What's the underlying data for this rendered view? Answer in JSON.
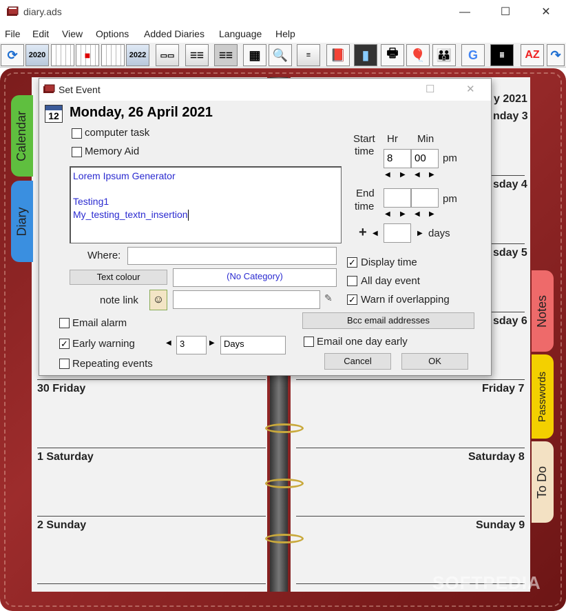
{
  "window": {
    "title": "diary.ads",
    "min_glyph": "—",
    "max_glyph": "☐",
    "close_glyph": "✕"
  },
  "menu": [
    "File",
    "Edit",
    "View",
    "Options",
    "Added Diaries",
    "Language",
    "Help"
  ],
  "toolbar": {
    "year_prev": "2020",
    "year_next": "2022",
    "sort_label": "AZ"
  },
  "diary": {
    "left_days": [
      "30 Friday",
      "1 Saturday",
      "2 Sunday"
    ],
    "right_days": [
      "Friday 7",
      "Saturday 8",
      "Sunday 9"
    ],
    "right_partial": [
      "y 2021",
      "nday 3",
      "sday 4",
      "sday 5",
      "sday 6"
    ],
    "tabs_left": [
      "Calendar",
      "Diary"
    ],
    "tabs_right": [
      "Notes",
      "Passwords",
      "To Do"
    ],
    "watermark": "SOFTPEDIA"
  },
  "dialog": {
    "title": "Set Event",
    "date_icon_day": "12",
    "date_heading": "Monday, 26 April 2021",
    "computer_task": {
      "label": "computer task",
      "checked": ""
    },
    "memory_aid": {
      "label": "Memory Aid",
      "checked": ""
    },
    "memo_lines": [
      "Lorem Ipsum Generator",
      "",
      "Testing1",
      "My_testing_textn_insertion"
    ],
    "where_label": "Where:",
    "where_value": "",
    "text_colour_button": "Text colour",
    "category_value": "(No Category)",
    "note_link_label": "note link",
    "note_link_value": "",
    "start_time_label": [
      "Start",
      "time"
    ],
    "hr_label": "Hr",
    "min_label": "Min",
    "start_hr": "8",
    "start_min": "00",
    "start_ampm": "pm",
    "end_time_label": [
      "End",
      "time"
    ],
    "end_hr": "",
    "end_min": "",
    "end_ampm": "pm",
    "days_plus": "+",
    "days_value": "",
    "days_label": "days",
    "display_time": {
      "label": "Display time",
      "checked": "✓"
    },
    "all_day_event": {
      "label": "All day event",
      "checked": ""
    },
    "warn_overlapping": {
      "label": "Warn if overlapping",
      "checked": "✓"
    },
    "bcc_button": "Bcc email addresses",
    "email_alarm": {
      "label": "Email alarm",
      "checked": ""
    },
    "early_warning": {
      "label": "Early warning",
      "checked": "✓"
    },
    "repeating_events": {
      "label": "Repeating events",
      "checked": ""
    },
    "early_warning_value": "3",
    "early_warning_unit": "Days",
    "email_one_day_early": {
      "label": "Email one day early",
      "checked": ""
    },
    "cancel_button": "Cancel",
    "ok_button": "OK"
  }
}
